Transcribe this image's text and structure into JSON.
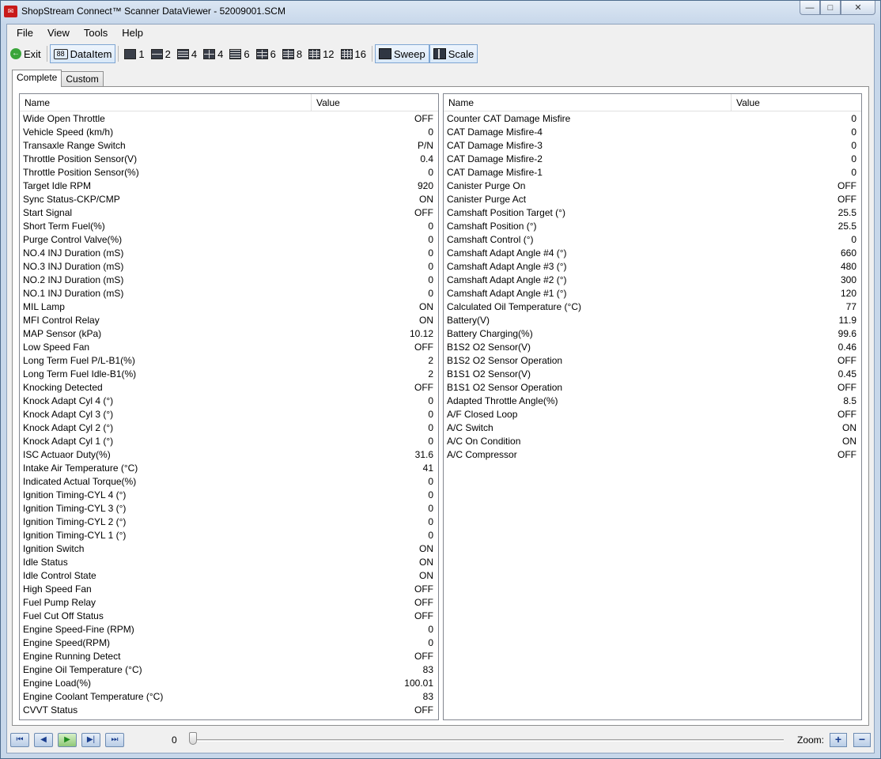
{
  "window": {
    "title": "ShopStream Connect™ Scanner DataViewer - 52009001.SCM",
    "app_icon": "logo-icon",
    "controls": {
      "minimize": "—",
      "maximize": "□",
      "close": "✕"
    }
  },
  "menu": [
    "File",
    "View",
    "Tools",
    "Help"
  ],
  "toolbar": {
    "exit": "Exit",
    "dataitem": "DataItem",
    "dataitem_icon": "88",
    "layouts": [
      "1",
      "2",
      "4",
      "4",
      "6",
      "6",
      "8",
      "12",
      "16"
    ],
    "sweep": "Sweep",
    "scale": "Scale"
  },
  "tabs": [
    "Complete",
    "Custom"
  ],
  "columns": {
    "name": "Name",
    "value": "Value"
  },
  "left_rows": [
    {
      "name": "Wide Open Throttle",
      "value": "OFF"
    },
    {
      "name": "Vehicle Speed (km/h)",
      "value": "0"
    },
    {
      "name": "Transaxle Range Switch",
      "value": "P/N"
    },
    {
      "name": "Throttle Position Sensor(V)",
      "value": "0.4"
    },
    {
      "name": "Throttle Position Sensor(%)",
      "value": "0"
    },
    {
      "name": "Target Idle RPM",
      "value": "920"
    },
    {
      "name": "Sync Status-CKP/CMP",
      "value": "ON"
    },
    {
      "name": "Start Signal",
      "value": "OFF"
    },
    {
      "name": "Short Term Fuel(%)",
      "value": "0"
    },
    {
      "name": "Purge Control Valve(%)",
      "value": "0"
    },
    {
      "name": "NO.4 INJ Duration (mS)",
      "value": "0"
    },
    {
      "name": "NO.3 INJ Duration (mS)",
      "value": "0"
    },
    {
      "name": "NO.2 INJ Duration (mS)",
      "value": "0"
    },
    {
      "name": "NO.1 INJ Duration (mS)",
      "value": "0"
    },
    {
      "name": "MIL Lamp",
      "value": "ON"
    },
    {
      "name": "MFI Control Relay",
      "value": "ON"
    },
    {
      "name": "MAP Sensor (kPa)",
      "value": "10.12"
    },
    {
      "name": "Low Speed Fan",
      "value": "OFF"
    },
    {
      "name": "Long Term Fuel P/L-B1(%)",
      "value": "2"
    },
    {
      "name": "Long Term Fuel Idle-B1(%)",
      "value": "2"
    },
    {
      "name": "Knocking Detected",
      "value": "OFF"
    },
    {
      "name": "Knock Adapt Cyl 4 (°)",
      "value": "0"
    },
    {
      "name": "Knock Adapt Cyl 3 (°)",
      "value": "0"
    },
    {
      "name": "Knock Adapt Cyl 2 (°)",
      "value": "0"
    },
    {
      "name": "Knock Adapt Cyl 1 (°)",
      "value": "0"
    },
    {
      "name": "ISC Actuaor Duty(%)",
      "value": "31.6"
    },
    {
      "name": "Intake Air Temperature (°C)",
      "value": "41"
    },
    {
      "name": "Indicated Actual Torque(%)",
      "value": "0"
    },
    {
      "name": "Ignition Timing-CYL 4 (°)",
      "value": "0"
    },
    {
      "name": "Ignition Timing-CYL 3 (°)",
      "value": "0"
    },
    {
      "name": "Ignition Timing-CYL 2 (°)",
      "value": "0"
    },
    {
      "name": "Ignition Timing-CYL 1 (°)",
      "value": "0"
    },
    {
      "name": "Ignition Switch",
      "value": "ON"
    },
    {
      "name": "Idle Status",
      "value": "ON"
    },
    {
      "name": "Idle Control State",
      "value": "ON"
    },
    {
      "name": "High Speed Fan",
      "value": "OFF"
    },
    {
      "name": "Fuel Pump Relay",
      "value": "OFF"
    },
    {
      "name": "Fuel Cut Off Status",
      "value": "OFF"
    },
    {
      "name": "Engine Speed-Fine (RPM)",
      "value": "0"
    },
    {
      "name": "Engine Speed(RPM)",
      "value": "0"
    },
    {
      "name": "Engine Running Detect",
      "value": "OFF"
    },
    {
      "name": "Engine Oil Temperature (°C)",
      "value": "83"
    },
    {
      "name": "Engine Load(%)",
      "value": "100.01"
    },
    {
      "name": "Engine Coolant Temperature (°C)",
      "value": "83"
    },
    {
      "name": "CVVT Status",
      "value": "OFF"
    }
  ],
  "right_rows": [
    {
      "name": "Counter CAT Damage Misfire",
      "value": "0"
    },
    {
      "name": "CAT Damage Misfire-4",
      "value": "0"
    },
    {
      "name": "CAT Damage Misfire-3",
      "value": "0"
    },
    {
      "name": "CAT Damage Misfire-2",
      "value": "0"
    },
    {
      "name": "CAT Damage Misfire-1",
      "value": "0"
    },
    {
      "name": "Canister Purge On",
      "value": "OFF"
    },
    {
      "name": "Canister Purge Act",
      "value": "OFF"
    },
    {
      "name": "Camshaft Position Target (°)",
      "value": "25.5"
    },
    {
      "name": "Camshaft Position (°)",
      "value": "25.5"
    },
    {
      "name": "Camshaft Control (°)",
      "value": "0"
    },
    {
      "name": "Camshaft Adapt Angle #4 (°)",
      "value": "660"
    },
    {
      "name": "Camshaft Adapt Angle #3 (°)",
      "value": "480"
    },
    {
      "name": "Camshaft Adapt Angle #2 (°)",
      "value": "300"
    },
    {
      "name": "Camshaft Adapt Angle #1 (°)",
      "value": "120"
    },
    {
      "name": "Calculated Oil Temperature (°C)",
      "value": "77"
    },
    {
      "name": "Battery(V)",
      "value": "11.9"
    },
    {
      "name": "Battery Charging(%)",
      "value": "99.6"
    },
    {
      "name": "B1S2 O2 Sensor(V)",
      "value": "0.46"
    },
    {
      "name": "B1S2 O2 Sensor Operation",
      "value": "OFF"
    },
    {
      "name": "B1S1 O2 Sensor(V)",
      "value": "0.45"
    },
    {
      "name": "B1S1 O2 Sensor Operation",
      "value": "OFF"
    },
    {
      "name": "Adapted Throttle Angle(%)",
      "value": "8.5"
    },
    {
      "name": "A/F Closed Loop",
      "value": "OFF"
    },
    {
      "name": "A/C Switch",
      "value": "ON"
    },
    {
      "name": "A/C On Condition",
      "value": "ON"
    },
    {
      "name": "A/C Compressor",
      "value": "OFF"
    }
  ],
  "playback": {
    "buttons": [
      "⏮",
      "◀",
      "▶",
      "▶|",
      "⏭"
    ],
    "position": "0",
    "slider_fraction": 0.0,
    "zoom_label": "Zoom:",
    "zoom_in": "+",
    "zoom_out": "−"
  },
  "colors": {
    "accent": "#7fa6d3",
    "title_bg": "#c7d7ea"
  }
}
